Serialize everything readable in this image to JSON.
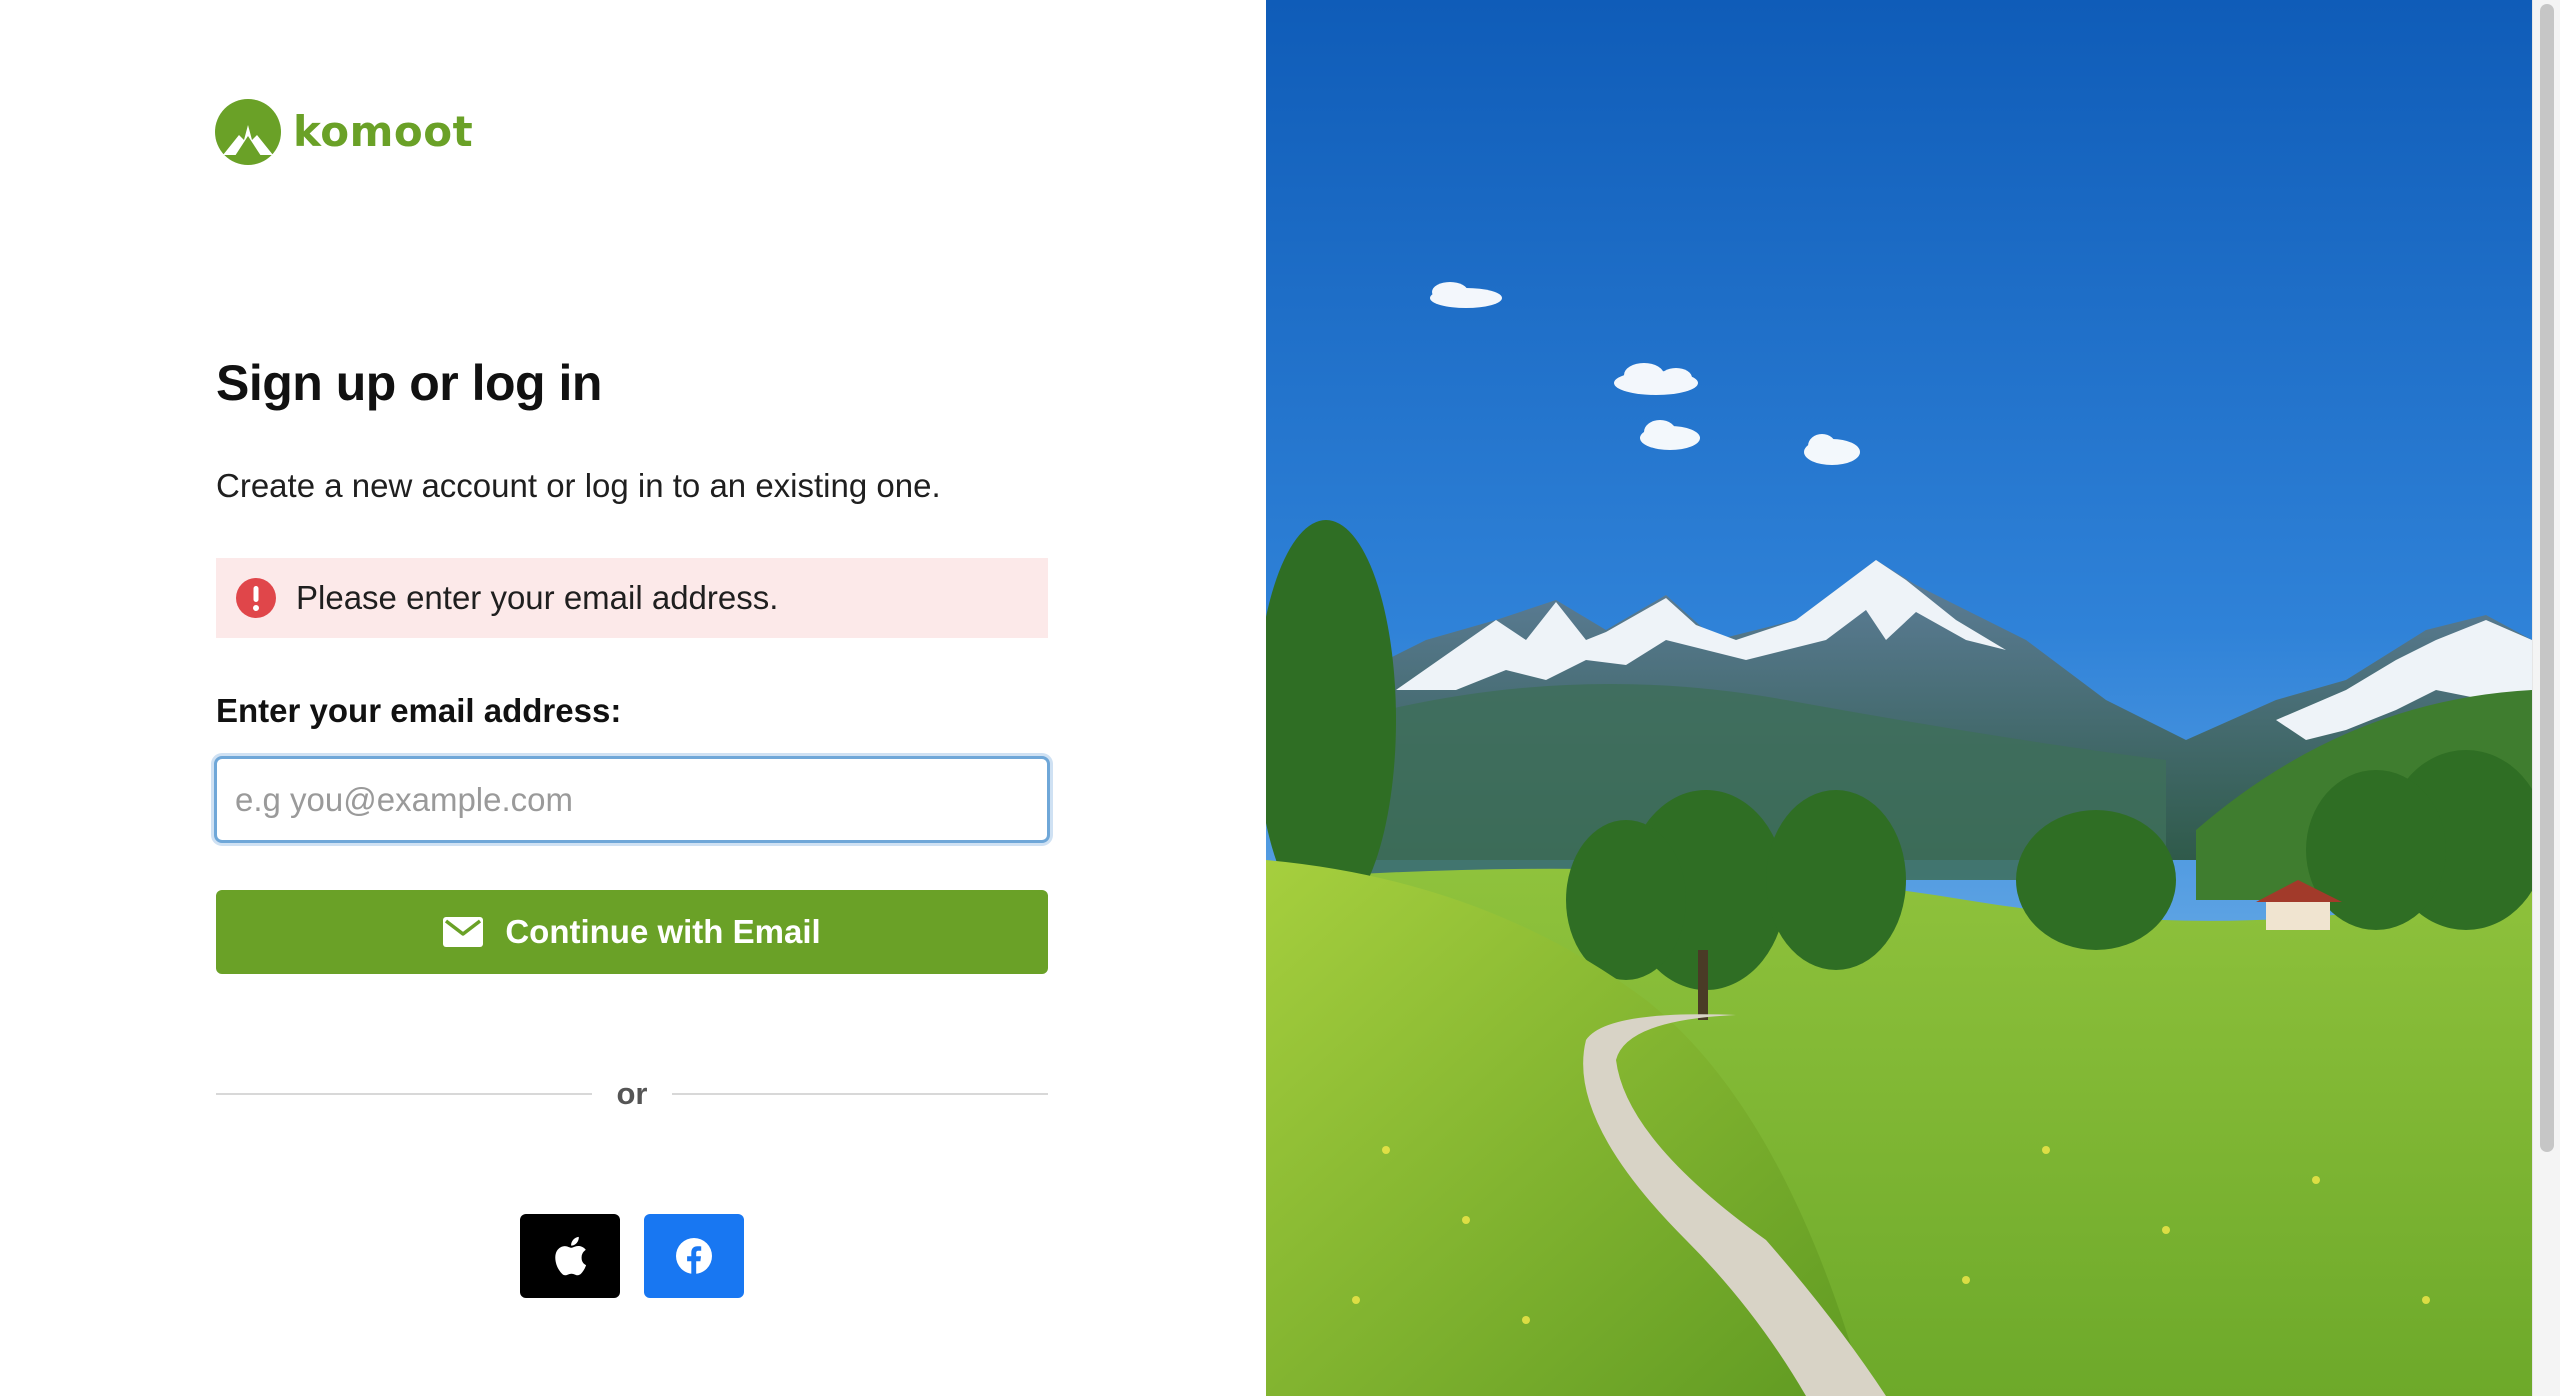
{
  "brand": {
    "name": "komoot",
    "accent": "#6aa127"
  },
  "login": {
    "title": "Sign up or log in",
    "subtitle": "Create a new account or log in to an existing one.",
    "error": {
      "message": "Please enter your email address.",
      "icon": "exclamation-circle-icon",
      "color": "#e0464a"
    },
    "email": {
      "label": "Enter your email address:",
      "placeholder": "e.g you@example.com",
      "value": ""
    },
    "continue": {
      "label": "Continue with Email",
      "icon": "envelope-icon"
    },
    "divider": "or",
    "social": [
      {
        "provider": "apple",
        "icon": "apple-icon",
        "color": "#000000"
      },
      {
        "provider": "facebook",
        "icon": "facebook-icon",
        "color": "#1877f2"
      }
    ]
  },
  "hero": {
    "scene": "alpine-meadow-landscape"
  }
}
